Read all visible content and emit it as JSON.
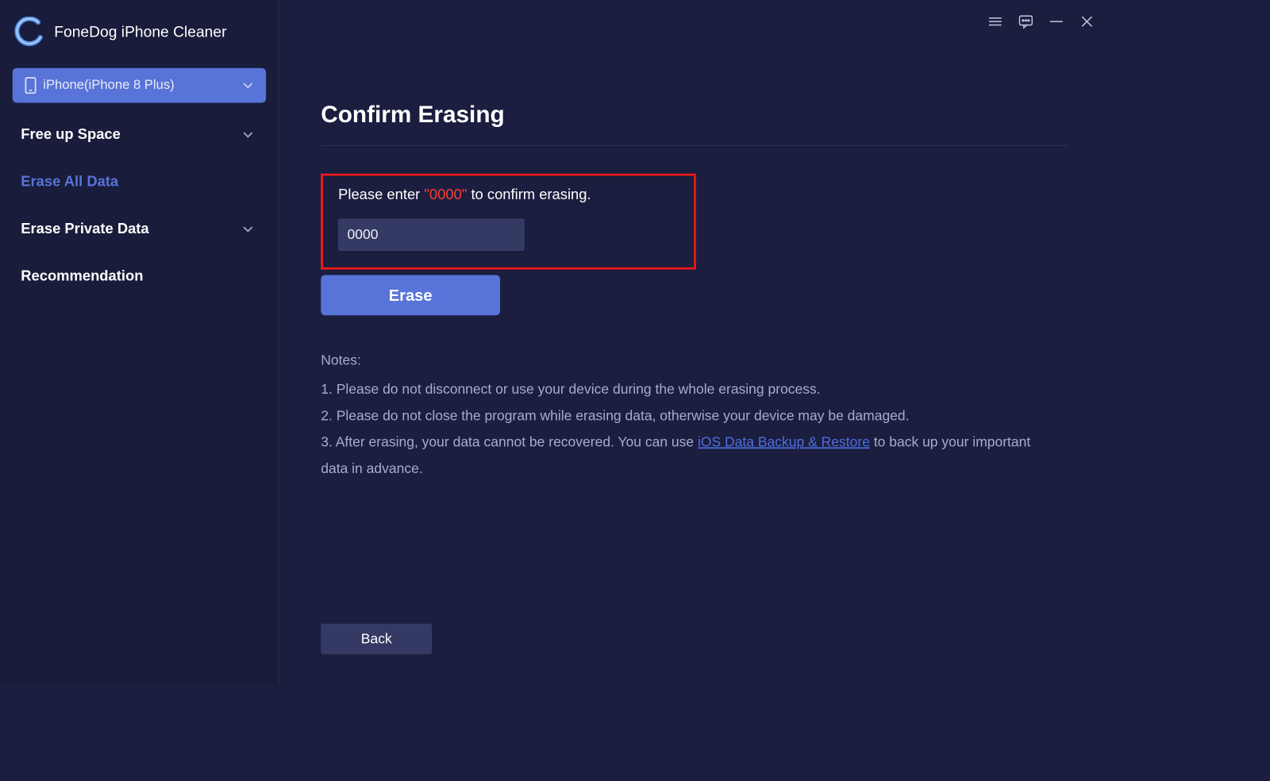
{
  "app": {
    "title": "FoneDog iPhone Cleaner"
  },
  "device": {
    "label": "iPhone(iPhone 8 Plus)"
  },
  "sidebar": {
    "items": [
      {
        "label": "Free up Space",
        "expandable": true,
        "active": false
      },
      {
        "label": "Erase All Data",
        "expandable": false,
        "active": true
      },
      {
        "label": "Erase Private Data",
        "expandable": true,
        "active": false
      },
      {
        "label": "Recommendation",
        "expandable": false,
        "active": false
      }
    ]
  },
  "main": {
    "title": "Confirm Erasing",
    "prompt_prefix": "Please enter ",
    "prompt_code": "\"0000\"",
    "prompt_suffix": " to confirm erasing.",
    "input_value": "0000",
    "erase_label": "Erase",
    "back_label": "Back"
  },
  "notes": {
    "heading": "Notes:",
    "line1": "1. Please do not disconnect or use your device during the whole erasing process.",
    "line2": "2. Please do not close the program while erasing data, otherwise your device may be damaged.",
    "line3_prefix": "3. After erasing, your data cannot be recovered. You can use ",
    "line3_link": "iOS Data Backup & Restore",
    "line3_suffix": " to back up your important data in advance."
  }
}
